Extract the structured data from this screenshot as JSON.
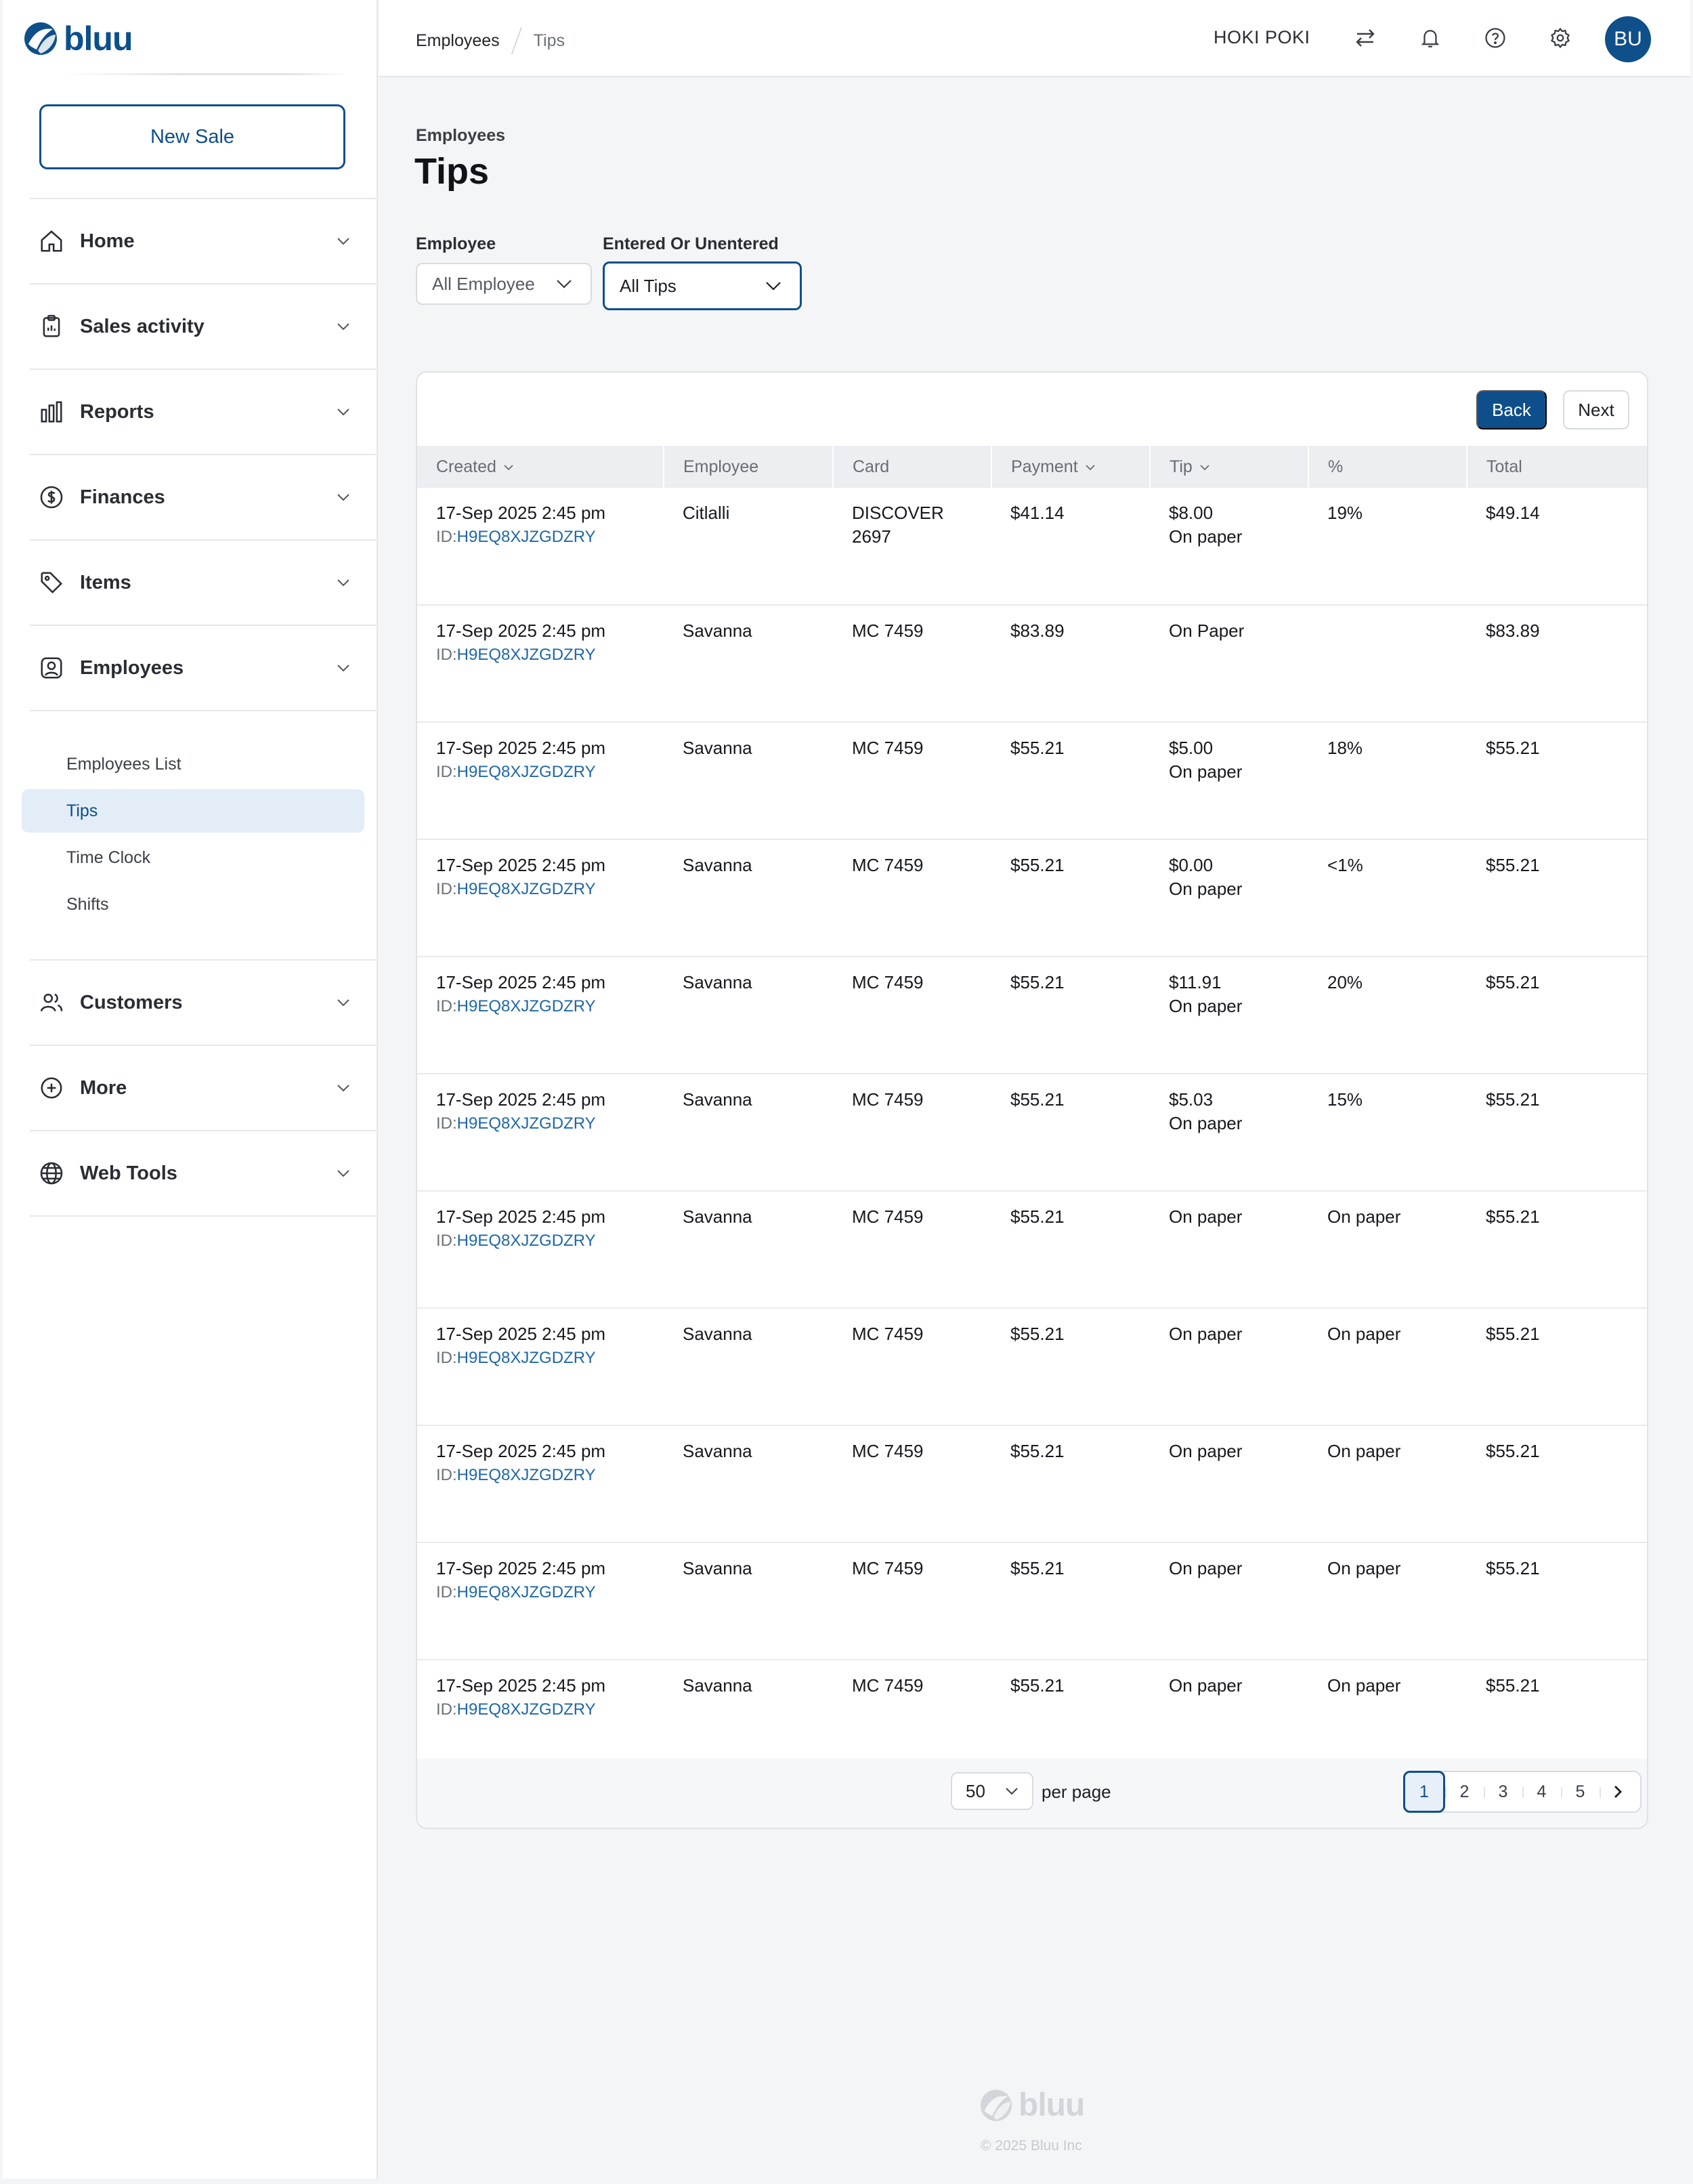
{
  "brand": {
    "name": "bluu"
  },
  "sidebar": {
    "new_sale": "New Sale",
    "items": [
      {
        "label": "Home",
        "icon": "home-icon"
      },
      {
        "label": "Sales activity",
        "icon": "clipboard-icon"
      },
      {
        "label": "Reports",
        "icon": "bar-chart-icon"
      },
      {
        "label": "Finances",
        "icon": "dollar-icon"
      },
      {
        "label": "Items",
        "icon": "tag-icon"
      },
      {
        "label": "Employees",
        "icon": "user-badge-icon"
      },
      {
        "label": "Customers",
        "icon": "users-icon"
      },
      {
        "label": "More",
        "icon": "plus-circle-icon"
      },
      {
        "label": "Web Tools",
        "icon": "globe-icon"
      }
    ],
    "employees_sub": [
      "Employees List",
      "Tips",
      "Time Clock",
      "Shifts"
    ],
    "active_sub": "Tips"
  },
  "topbar": {
    "breadcrumb": [
      "Employees",
      "Tips"
    ],
    "store": "HOKI POKI",
    "avatar": "BU",
    "icons": [
      "switch-icon",
      "bell-icon",
      "help-icon",
      "settings-icon"
    ]
  },
  "page": {
    "eyebrow": "Employees",
    "title": "Tips",
    "filters": {
      "employee_label": "Employee",
      "employee_value": "All Employee",
      "entered_label": "Entered Or Unentered",
      "entered_value": "All Tips"
    },
    "back": "Back",
    "next": "Next"
  },
  "table": {
    "columns": [
      "Created",
      "Employee",
      "Card",
      "Payment",
      "Tip",
      "%",
      "Total"
    ],
    "id_prefix": "ID:",
    "rows": [
      {
        "created": "17-Sep 2025 2:45 pm",
        "id": "H9EQ8XJZGDZRY",
        "employee": "Citlalli",
        "card": "DISCOVER",
        "card2": "2697",
        "payment": "$41.14",
        "tip": "$8.00",
        "tip2": "On paper",
        "pct": "19%",
        "total": "$49.14"
      },
      {
        "created": "17-Sep 2025 2:45 pm",
        "id": "H9EQ8XJZGDZRY",
        "employee": "Savanna",
        "card": "MC 7459",
        "card2": "",
        "payment": "$83.89",
        "tip": "On Paper",
        "tip2": "",
        "pct": "",
        "total": "$83.89"
      },
      {
        "created": "17-Sep 2025 2:45 pm",
        "id": "H9EQ8XJZGDZRY",
        "employee": "Savanna",
        "card": "MC 7459",
        "card2": "",
        "payment": "$55.21",
        "tip": "$5.00",
        "tip2": "On paper",
        "pct": "18%",
        "total": "$55.21"
      },
      {
        "created": "17-Sep 2025 2:45 pm",
        "id": "H9EQ8XJZGDZRY",
        "employee": "Savanna",
        "card": "MC 7459",
        "card2": "",
        "payment": "$55.21",
        "tip": "$0.00",
        "tip2": "On paper",
        "pct": "<1%",
        "total": "$55.21"
      },
      {
        "created": "17-Sep 2025 2:45 pm",
        "id": "H9EQ8XJZGDZRY",
        "employee": "Savanna",
        "card": "MC 7459",
        "card2": "",
        "payment": "$55.21",
        "tip": "$11.91",
        "tip2": "On paper",
        "pct": "20%",
        "total": "$55.21"
      },
      {
        "created": "17-Sep 2025 2:45 pm",
        "id": "H9EQ8XJZGDZRY",
        "employee": "Savanna",
        "card": "MC 7459",
        "card2": "",
        "payment": "$55.21",
        "tip": "$5.03",
        "tip2": "On paper",
        "pct": "15%",
        "total": "$55.21"
      },
      {
        "created": "17-Sep 2025 2:45 pm",
        "id": "H9EQ8XJZGDZRY",
        "employee": "Savanna",
        "card": "MC 7459",
        "card2": "",
        "payment": "$55.21",
        "tip": "On paper",
        "tip2": "",
        "pct": "On paper",
        "total": "$55.21"
      },
      {
        "created": "17-Sep 2025 2:45 pm",
        "id": "H9EQ8XJZGDZRY",
        "employee": "Savanna",
        "card": "MC 7459",
        "card2": "",
        "payment": "$55.21",
        "tip": "On paper",
        "tip2": "",
        "pct": "On paper",
        "total": "$55.21"
      },
      {
        "created": "17-Sep 2025 2:45 pm",
        "id": "H9EQ8XJZGDZRY",
        "employee": "Savanna",
        "card": "MC 7459",
        "card2": "",
        "payment": "$55.21",
        "tip": "On paper",
        "tip2": "",
        "pct": "On paper",
        "total": "$55.21"
      },
      {
        "created": "17-Sep 2025 2:45 pm",
        "id": "H9EQ8XJZGDZRY",
        "employee": "Savanna",
        "card": "MC 7459",
        "card2": "",
        "payment": "$55.21",
        "tip": "On paper",
        "tip2": "",
        "pct": "On paper",
        "total": "$55.21"
      },
      {
        "created": "17-Sep 2025 2:45 pm",
        "id": "H9EQ8XJZGDZRY",
        "employee": "Savanna",
        "card": "MC 7459",
        "card2": "",
        "payment": "$55.21",
        "tip": "On paper",
        "tip2": "",
        "pct": "On paper",
        "total": "$55.21"
      }
    ]
  },
  "pagination": {
    "per_page_value": "50",
    "per_page_label": "per page",
    "pages": [
      "1",
      "2",
      "3",
      "4",
      "5"
    ],
    "current": "1"
  },
  "footer": {
    "copyright": "© 2025 Bluu Inc"
  },
  "colors": {
    "brand": "#0e4f8b",
    "link": "#1f67a6",
    "active_bg": "#e3edf7"
  }
}
